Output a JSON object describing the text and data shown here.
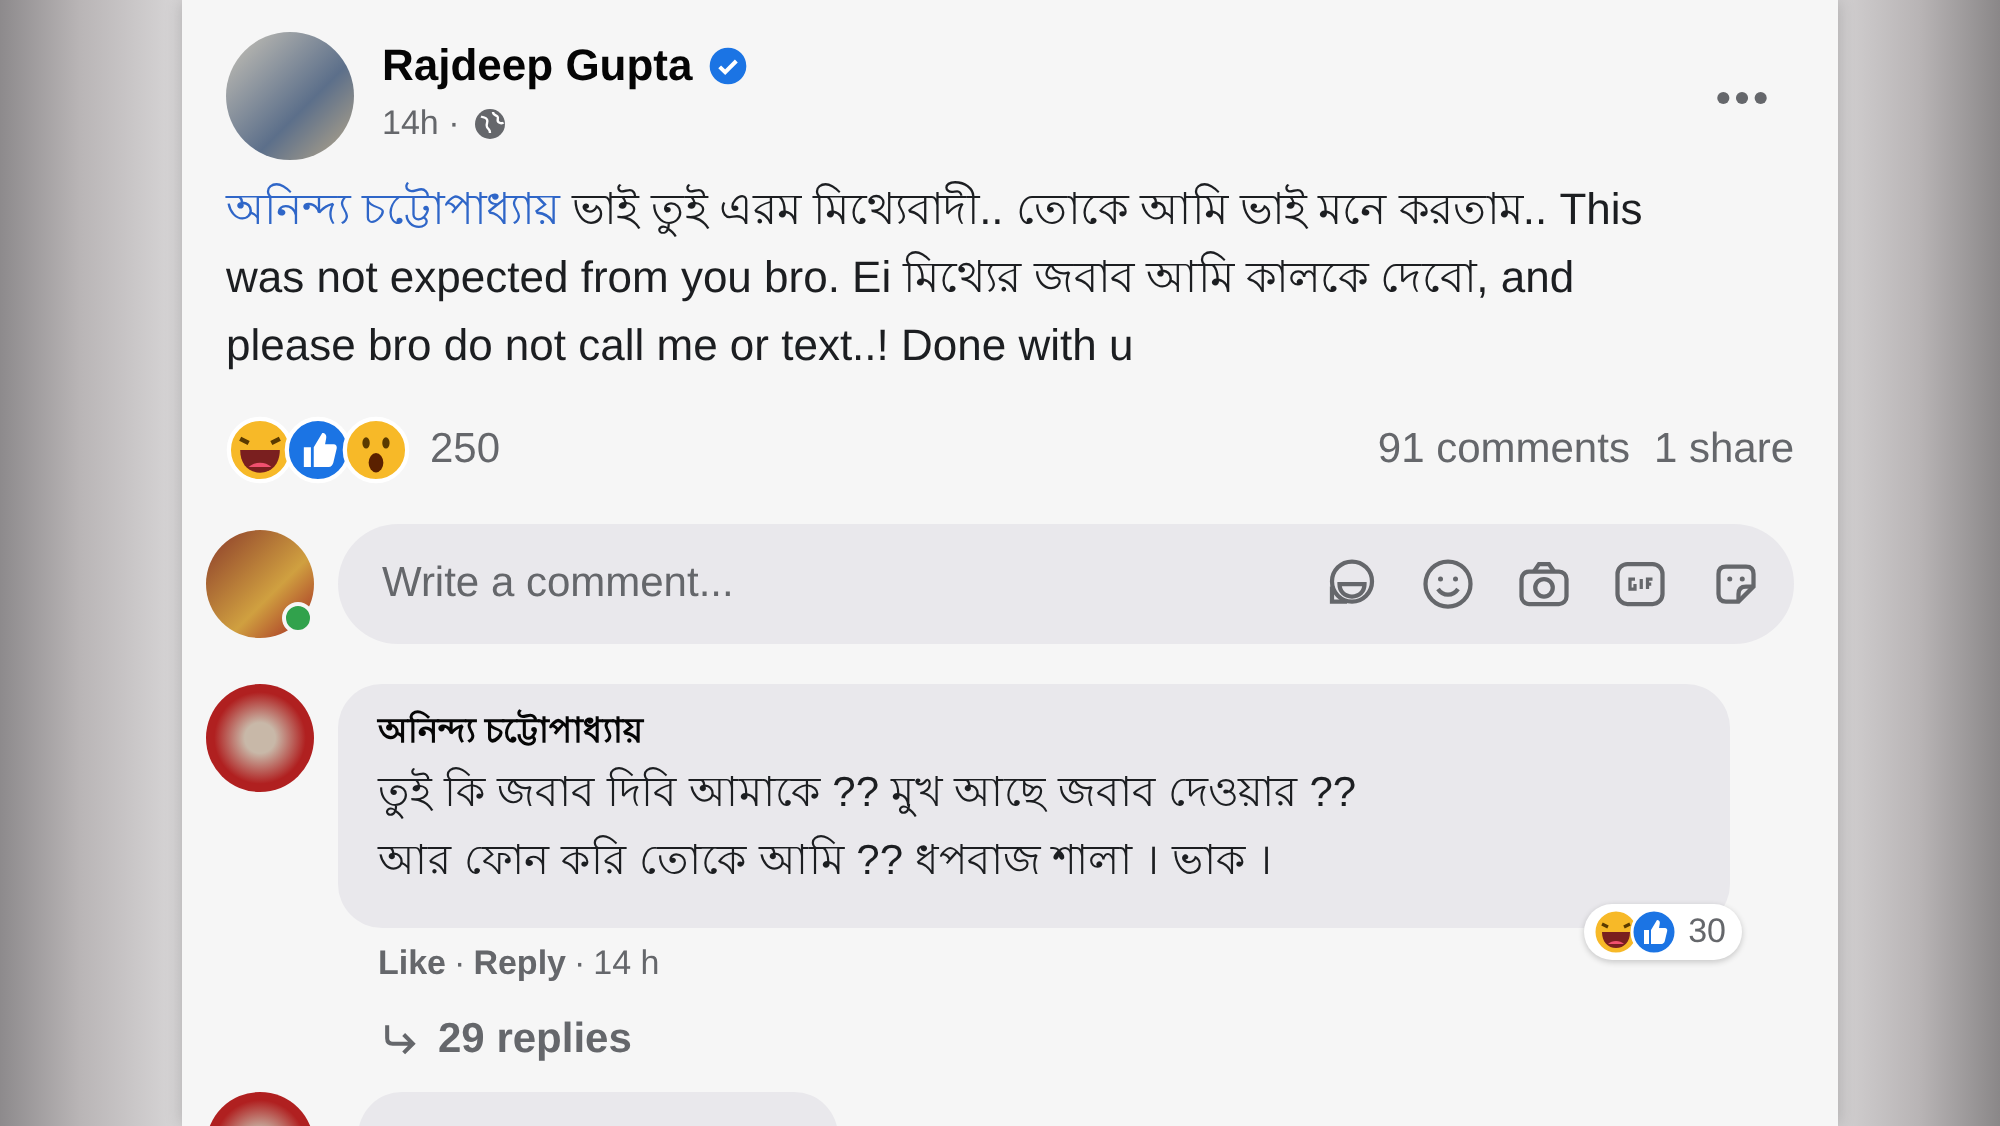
{
  "post": {
    "author": "Rajdeep Gupta",
    "verified": true,
    "time": "14h ·",
    "mention": "অনিন্দ্য চট্টোপাধ্যায়",
    "text": " ভাই তুই এরম মিথ্যেবাদী.. তোকে আমি ভাই মনে করতাম.. This was not expected from you bro. Ei মিথ্যের জবাব আমি কালকে দেবো, and please bro do not call me or text..! Done with u",
    "reaction_count": "250",
    "comments": "91 comments",
    "shares": "1 share"
  },
  "composer": {
    "placeholder": "Write a comment...",
    "online": true
  },
  "comments": [
    {
      "author": "অনিন্দ্য চট্টোপাধ্যায়",
      "lines": [
        "তুই কি জবাব দিবি আমাকে ?? মুখ আছে জবাব দেওয়ার ??",
        "আর ফোন করি তোকে আমি ?? ধপবাজ শালা । ভাক ।"
      ],
      "like": "Like",
      "reply": "Reply",
      "separator": "·",
      "time": "14 h",
      "reaction_count": "30",
      "replies": "29 replies"
    }
  ]
}
